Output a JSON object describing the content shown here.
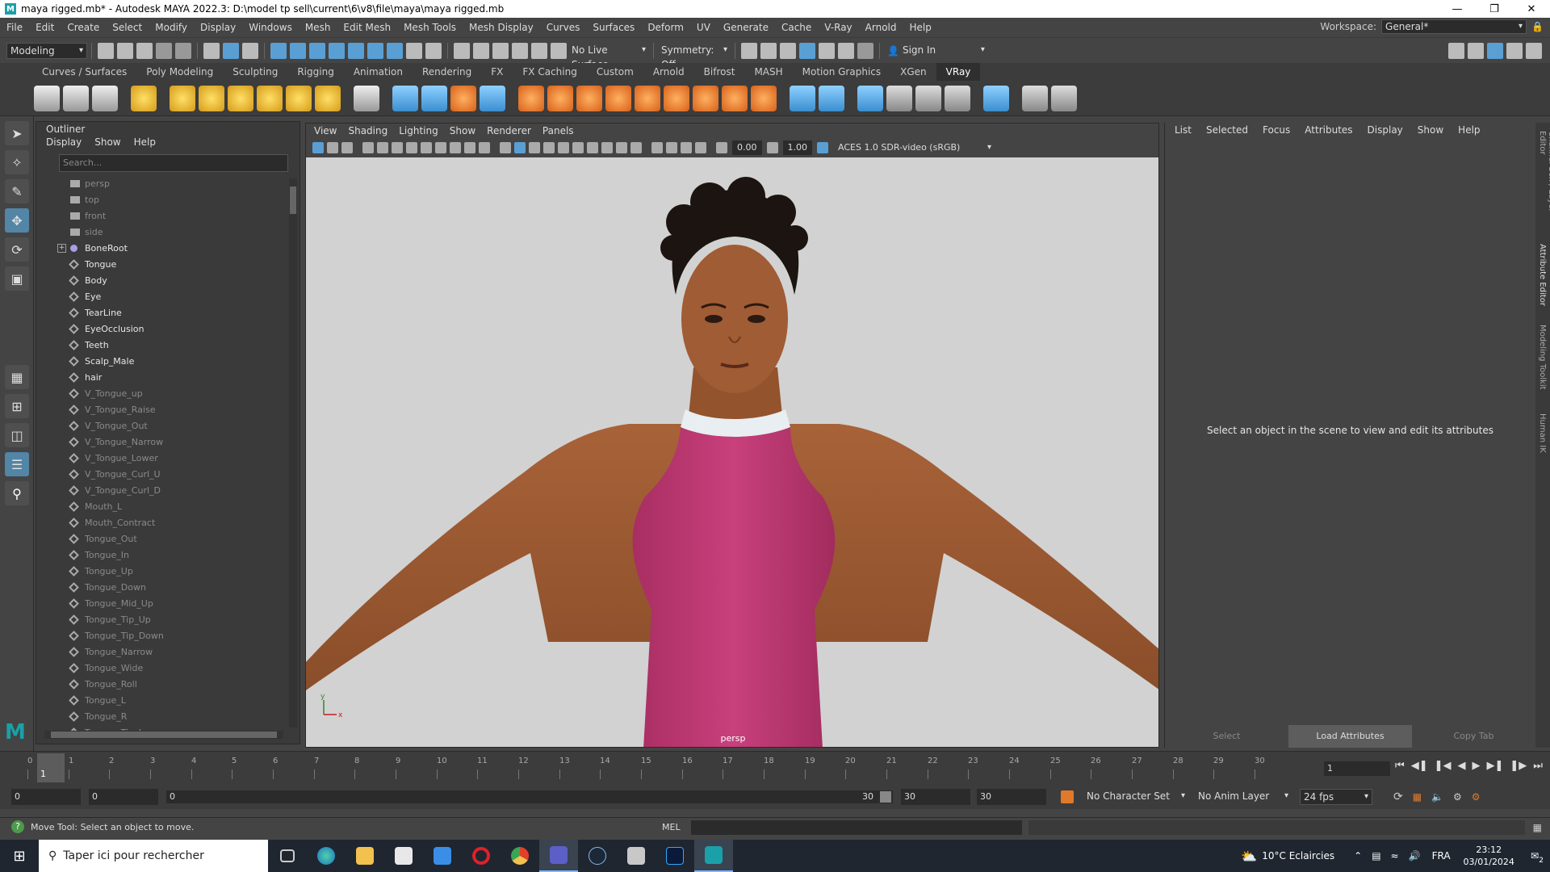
{
  "window": {
    "title": "maya rigged.mb* - Autodesk MAYA 2022.3: D:\\model tp sell\\current\\6\\v8\\file\\maya\\maya rigged.mb",
    "logo": "M"
  },
  "menubar": {
    "items": [
      "File",
      "Edit",
      "Create",
      "Select",
      "Modify",
      "Display",
      "Windows",
      "Mesh",
      "Edit Mesh",
      "Mesh Tools",
      "Mesh Display",
      "Curves",
      "Surfaces",
      "Deform",
      "UV",
      "Generate",
      "Cache",
      "V-Ray",
      "Arnold",
      "Help"
    ],
    "workspace_label": "Workspace:",
    "workspace_value": "General*"
  },
  "statusline": {
    "mode": "Modeling",
    "live_surface": "No Live Surface",
    "symmetry": "Symmetry: Off",
    "sign_in": "Sign In"
  },
  "shelf": {
    "tabs": [
      "Curves / Surfaces",
      "Poly Modeling",
      "Sculpting",
      "Rigging",
      "Animation",
      "Rendering",
      "FX",
      "FX Caching",
      "Custom",
      "Arnold",
      "Bifrost",
      "MASH",
      "Motion Graphics",
      "XGen",
      "VRay"
    ],
    "active_tab": "VRay"
  },
  "outliner": {
    "title": "Outliner",
    "menu": [
      "Display",
      "Show",
      "Help"
    ],
    "search_placeholder": "Search...",
    "items": [
      {
        "name": "persp",
        "type": "cam",
        "visible": false
      },
      {
        "name": "top",
        "type": "cam",
        "visible": false
      },
      {
        "name": "front",
        "type": "cam",
        "visible": false
      },
      {
        "name": "side",
        "type": "cam",
        "visible": false
      },
      {
        "name": "BoneRoot",
        "type": "joint",
        "visible": true,
        "expandable": true
      },
      {
        "name": "Tongue",
        "type": "mesh",
        "visible": true
      },
      {
        "name": "Body",
        "type": "mesh",
        "visible": true
      },
      {
        "name": "Eye",
        "type": "mesh",
        "visible": true
      },
      {
        "name": "TearLine",
        "type": "mesh",
        "visible": true
      },
      {
        "name": "EyeOcclusion",
        "type": "mesh",
        "visible": true
      },
      {
        "name": "Teeth",
        "type": "mesh",
        "visible": true
      },
      {
        "name": "Scalp_Male",
        "type": "mesh",
        "visible": true
      },
      {
        "name": "hair",
        "type": "mesh",
        "visible": true
      },
      {
        "name": "V_Tongue_up",
        "type": "mesh",
        "visible": false
      },
      {
        "name": "V_Tongue_Raise",
        "type": "mesh",
        "visible": false
      },
      {
        "name": "V_Tongue_Out",
        "type": "mesh",
        "visible": false
      },
      {
        "name": "V_Tongue_Narrow",
        "type": "mesh",
        "visible": false
      },
      {
        "name": "V_Tongue_Lower",
        "type": "mesh",
        "visible": false
      },
      {
        "name": "V_Tongue_Curl_U",
        "type": "mesh",
        "visible": false
      },
      {
        "name": "V_Tongue_Curl_D",
        "type": "mesh",
        "visible": false
      },
      {
        "name": "Mouth_L",
        "type": "mesh",
        "visible": false
      },
      {
        "name": "Mouth_Contract",
        "type": "mesh",
        "visible": false
      },
      {
        "name": "Tongue_Out",
        "type": "mesh",
        "visible": false
      },
      {
        "name": "Tongue_In",
        "type": "mesh",
        "visible": false
      },
      {
        "name": "Tongue_Up",
        "type": "mesh",
        "visible": false
      },
      {
        "name": "Tongue_Down",
        "type": "mesh",
        "visible": false
      },
      {
        "name": "Tongue_Mid_Up",
        "type": "mesh",
        "visible": false
      },
      {
        "name": "Tongue_Tip_Up",
        "type": "mesh",
        "visible": false
      },
      {
        "name": "Tongue_Tip_Down",
        "type": "mesh",
        "visible": false
      },
      {
        "name": "Tongue_Narrow",
        "type": "mesh",
        "visible": false
      },
      {
        "name": "Tongue_Wide",
        "type": "mesh",
        "visible": false
      },
      {
        "name": "Tongue_Roll",
        "type": "mesh",
        "visible": false
      },
      {
        "name": "Tongue_L",
        "type": "mesh",
        "visible": false
      },
      {
        "name": "Tongue_R",
        "type": "mesh",
        "visible": false
      },
      {
        "name": "Tongue_Tip_L",
        "type": "mesh",
        "visible": false
      }
    ]
  },
  "viewport": {
    "menu": [
      "View",
      "Shading",
      "Lighting",
      "Show",
      "Renderer",
      "Panels"
    ],
    "field_a": "0.00",
    "field_b": "1.00",
    "color_space": "ACES 1.0 SDR-video (sRGB)",
    "camera_label": "persp",
    "colors": {
      "background": "#d2d2d2",
      "skin": "#9a5a32",
      "top": "#c23c78",
      "collar": "#e8eef2",
      "hair": "#1c1410"
    }
  },
  "attribute_editor": {
    "menu": [
      "List",
      "Selected",
      "Focus",
      "Attributes",
      "Display",
      "Show",
      "Help"
    ],
    "message": "Select an object in the scene to view and edit its attributes",
    "buttons": [
      "Select",
      "Load Attributes",
      "Copy Tab"
    ],
    "side_tabs": [
      "Channel Box / Layer Editor",
      "Attribute Editor",
      "Modeling Toolkit",
      "Human IK"
    ]
  },
  "timeline": {
    "ticks": [
      0,
      1,
      2,
      3,
      4,
      5,
      6,
      7,
      8,
      9,
      10,
      11,
      12,
      13,
      14,
      15,
      16,
      17,
      18,
      19,
      20,
      21,
      22,
      23,
      24,
      25,
      26,
      27,
      28,
      29,
      30
    ],
    "current_frame": "1",
    "frame_field": "1"
  },
  "range": {
    "start": "0",
    "anim_start": "0",
    "slider_left": "0",
    "slider_right": "30",
    "end": "30",
    "anim_end": "30",
    "character_set": "No Character Set",
    "anim_layer": "No Anim Layer",
    "fps": "24 fps"
  },
  "cmdline": {
    "help_text": "Move Tool: Select an object to move.",
    "mel_label": "MEL"
  },
  "taskbar": {
    "search_text": "Taper ici pour rechercher",
    "weather": "10°C  Eclaircies",
    "language": "FRA",
    "time": "23:12",
    "date": "03/01/2024",
    "notifications": "2"
  }
}
